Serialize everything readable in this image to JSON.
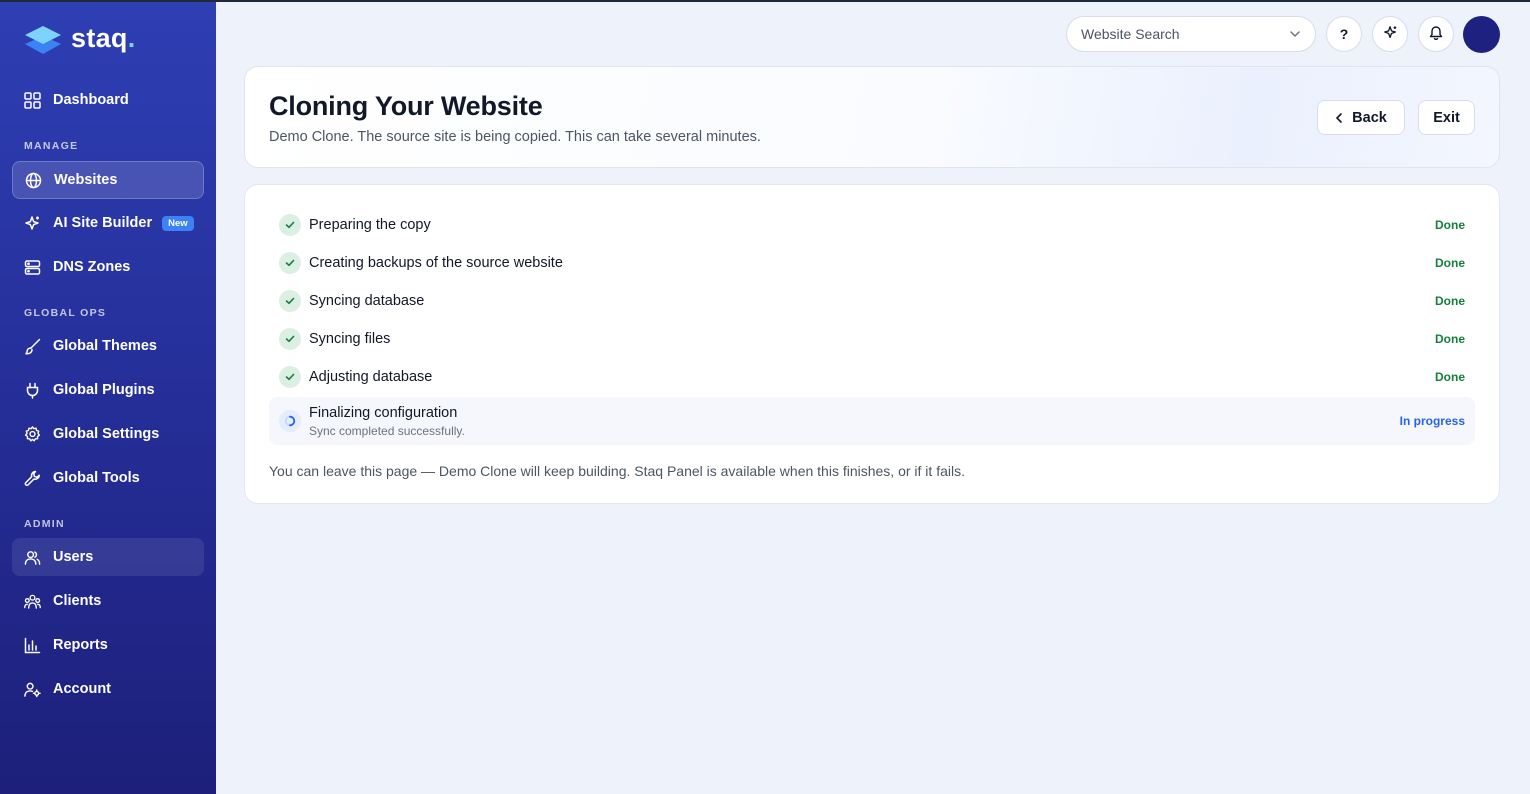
{
  "brand": {
    "name": "staq",
    "dot": "."
  },
  "sidebar": {
    "top_item": {
      "label": "Dashboard",
      "icon": "grid-icon"
    },
    "sections": [
      {
        "label": "MANAGE"
      },
      {
        "label": "GLOBAL OPS"
      },
      {
        "label": "ADMIN"
      }
    ],
    "items": [
      {
        "label": "Websites",
        "icon": "globe-icon",
        "active": true
      },
      {
        "label": "AI Site Builder",
        "icon": "sparkle-icon",
        "badge": "New"
      },
      {
        "label": "DNS Zones",
        "icon": "server-icon"
      },
      {
        "label": "Global Themes",
        "icon": "brush-icon"
      },
      {
        "label": "Global Plugins",
        "icon": "plug-icon"
      },
      {
        "label": "Global Settings",
        "icon": "gear-icon"
      },
      {
        "label": "Global Tools",
        "icon": "wrench-icon"
      },
      {
        "label": "Users",
        "icon": "users-icon",
        "hover": true
      },
      {
        "label": "Clients",
        "icon": "clients-icon"
      },
      {
        "label": "Reports",
        "icon": "bar-chart-icon"
      },
      {
        "label": "Account",
        "icon": "user-gear-icon"
      }
    ]
  },
  "topbar": {
    "search_placeholder": "Website Search",
    "help_label": "?",
    "icons": [
      "chevron-down-icon",
      "help-icon",
      "sparkle-icon",
      "bell-icon",
      "avatar"
    ]
  },
  "header": {
    "title": "Cloning Your Website",
    "subtitle": "Demo Clone. The source site is being copied. This can take several minutes.",
    "back_label": "Back",
    "exit_label": "Exit"
  },
  "steps": [
    {
      "label": "Preparing the copy",
      "status": "Done"
    },
    {
      "label": "Creating backups of the source website",
      "status": "Done"
    },
    {
      "label": "Syncing database",
      "status": "Done"
    },
    {
      "label": "Syncing files",
      "status": "Done"
    },
    {
      "label": "Adjusting database",
      "status": "Done"
    },
    {
      "label": "Finalizing configuration",
      "sub": "Sync completed successfully.",
      "status": "In progress"
    }
  ],
  "footer_note": "You can leave this page — Demo Clone will keep building. Staq Panel is available when this finishes, or if it fails.",
  "colors": {
    "sidebar_top": "#2e3fb4",
    "sidebar_bottom": "#1d1f7a",
    "done_green": "#15803d",
    "progress_blue": "#2563eb",
    "badge_blue": "#3b82f6",
    "background": "#eef2fa"
  }
}
